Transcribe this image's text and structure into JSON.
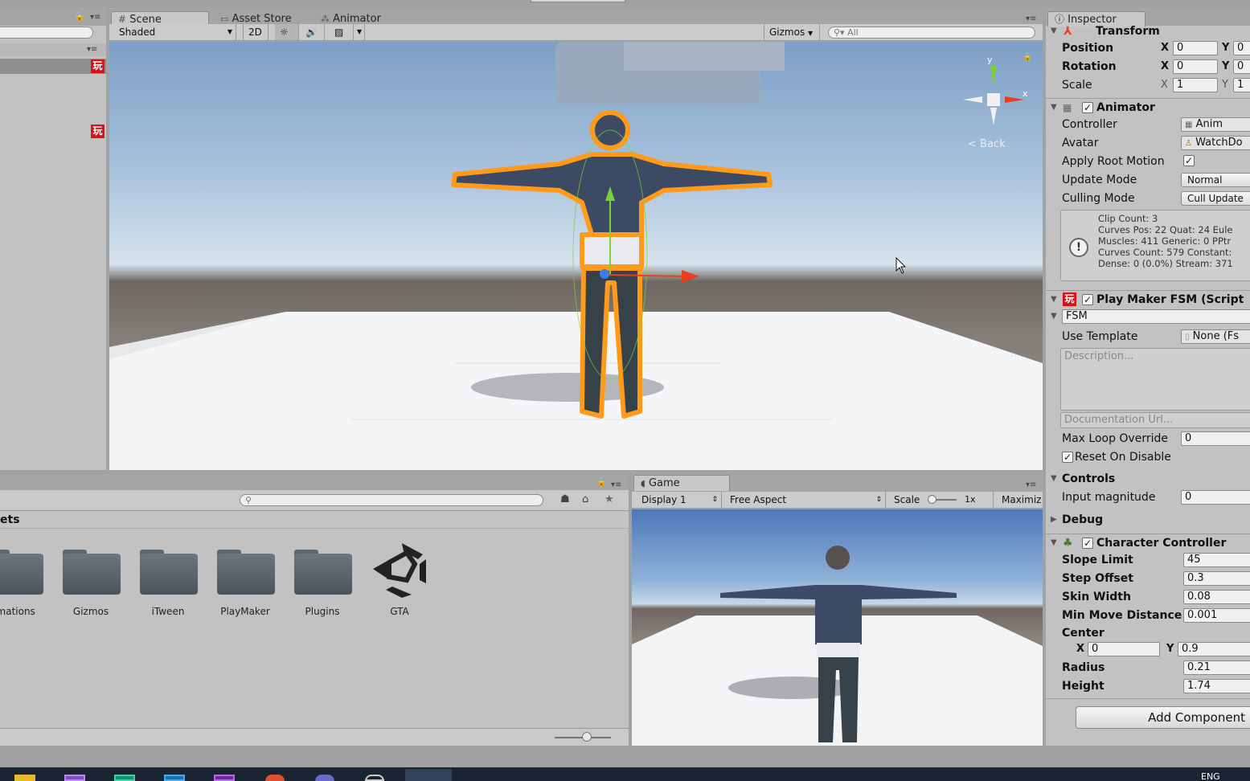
{
  "hierarchy": {
    "rows": [
      {
        "label": ""
      },
      {
        "label": ""
      }
    ]
  },
  "scene": {
    "tabs": [
      {
        "label": "Scene"
      },
      {
        "label": "Asset Store"
      },
      {
        "label": "Animator"
      }
    ],
    "toolbar": {
      "shading": "Shaded",
      "mode_2d": "2D",
      "gizmos": "Gizmos",
      "search_placeholder": "All"
    },
    "gizmo": {
      "back_label": "Back",
      "y_label": "y",
      "x_label": "x"
    }
  },
  "project": {
    "header": "ets",
    "folders": [
      {
        "label": "imations"
      },
      {
        "label": "Gizmos"
      },
      {
        "label": "iTween"
      },
      {
        "label": "PlayMaker"
      },
      {
        "label": "Plugins"
      },
      {
        "label": "GTA"
      }
    ]
  },
  "game": {
    "tab": "Game",
    "display": "Display 1",
    "aspect": "Free Aspect",
    "scale_label": "Scale",
    "scale_value": "1x",
    "maximize": "Maximiz"
  },
  "inspector": {
    "tab": "Inspector",
    "transform": {
      "title": "Transform",
      "position": {
        "label": "Position",
        "x": "0",
        "y": "0"
      },
      "rotation": {
        "label": "Rotation",
        "x": "0",
        "y": "0"
      },
      "scale": {
        "label": "Scale",
        "x": "1",
        "y": "1"
      },
      "axis_x": "X",
      "axis_y": "Y"
    },
    "animator": {
      "title": "Animator",
      "controller": {
        "label": "Controller",
        "value": "Anim"
      },
      "avatar": {
        "label": "Avatar",
        "value": "WatchDo"
      },
      "apply_root_motion": {
        "label": "Apply Root Motion",
        "checked": true
      },
      "update_mode": {
        "label": "Update Mode",
        "value": "Normal"
      },
      "culling_mode": {
        "label": "Culling Mode",
        "value": "Cull Update"
      },
      "info": [
        "Clip Count: 3",
        "Curves Pos: 22 Quat: 24 Eule",
        "Muscles: 411 Generic: 0 PPtr",
        "Curves Count: 579 Constant:",
        "Dense: 0 (0.0%) Stream: 371"
      ]
    },
    "playmaker": {
      "title": "Play Maker FSM (Script",
      "fsm_label": "FSM",
      "use_template": {
        "label": "Use Template",
        "value": "None (Fs"
      },
      "description_placeholder": "Description...",
      "doc_url_placeholder": "Documentation Url...",
      "max_loop": {
        "label": "Max Loop Override",
        "value": "0"
      },
      "reset_on_disable": {
        "label": "Reset On Disable",
        "checked": true
      },
      "controls_label": "Controls",
      "input_magnitude": {
        "label": "Input magnitude",
        "value": "0"
      },
      "debug_label": "Debug"
    },
    "character_controller": {
      "title": "Character Controller",
      "slope_limit": {
        "label": "Slope Limit",
        "value": "45"
      },
      "step_offset": {
        "label": "Step Offset",
        "value": "0.3"
      },
      "skin_width": {
        "label": "Skin Width",
        "value": "0.08"
      },
      "min_move": {
        "label": "Min Move Distance",
        "value": "0.001"
      },
      "center": {
        "label": "Center",
        "x": "0",
        "y": "0.9"
      },
      "radius": {
        "label": "Radius",
        "value": "0.21"
      },
      "height": {
        "label": "Height",
        "value": "1.74"
      }
    },
    "add_component": "Add Component"
  },
  "taskbar": {
    "lang": "ENG"
  },
  "colors": {
    "selection_outline": "#ff9a1a",
    "axis_x": "#e8401c",
    "axis_y": "#7ad13a",
    "axis_z": "#3a7fe8",
    "playmaker_red": "#d7141a"
  }
}
